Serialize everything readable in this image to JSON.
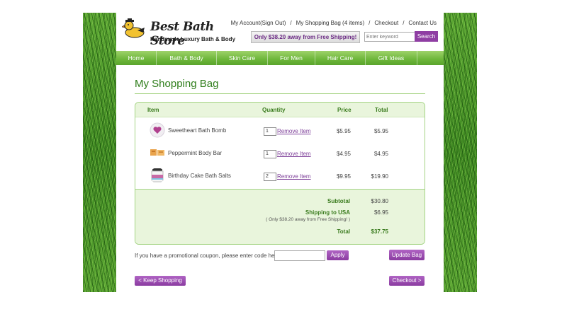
{
  "header": {
    "brand": "Best Bath Store",
    "tagline": "Handmade Luxury Bath & Body",
    "links": {
      "account": "My Account",
      "sign_out": "(Sign Out)",
      "bag": "My Shopping Bag (4 items)",
      "checkout": "Checkout",
      "contact": "Contact Us"
    },
    "separator": "/",
    "shipping_banner": "Only $38.20 away from Free Shipping!",
    "search_placeholder": "Enter keyword",
    "search_button": "Search"
  },
  "nav": [
    "Home",
    "Bath & Body",
    "Skin Care",
    "For Men",
    "Hair Care",
    "Gift Ideas"
  ],
  "main": {
    "title": "My Shopping Bag"
  },
  "cart": {
    "columns": {
      "item": "Item",
      "quantity": "Quantity",
      "price": "Price",
      "total": "Total"
    },
    "remove_label": "Remove Item",
    "items": [
      {
        "name": "Sweetheart Bath Bomb",
        "qty": "1",
        "price": "$5.95",
        "total": "$5.95",
        "icon": "bath-bomb-icon"
      },
      {
        "name": "Peppermint Body Bar",
        "qty": "1",
        "price": "$4.95",
        "total": "$4.95",
        "icon": "soap-bar-icon"
      },
      {
        "name": "Birthday Cake Bath Salts",
        "qty": "2",
        "price": "$9.95",
        "total": "$19.90",
        "icon": "bath-salts-jar-icon"
      }
    ],
    "summary": {
      "subtotal_label": "Subtotal",
      "subtotal": "$30.80",
      "shipping_label": "Shipping to USA",
      "shipping": "$6.95",
      "shipping_note": "( Only $38.20 away from Free Shipping! )",
      "total_label": "Total",
      "total": "$37.75"
    }
  },
  "coupon": {
    "label": "If you have a promotional coupon, please enter code here:",
    "value": "",
    "apply": "Apply"
  },
  "actions": {
    "update": "Update Bag",
    "keep_shopping": "< Keep Shopping",
    "checkout": "Checkout >"
  },
  "colors": {
    "accent_green": "#2e7d1a",
    "nav_green": "#6db63a",
    "button_purple": "#8a3ba0",
    "panel_green": "#e9f5dc"
  }
}
